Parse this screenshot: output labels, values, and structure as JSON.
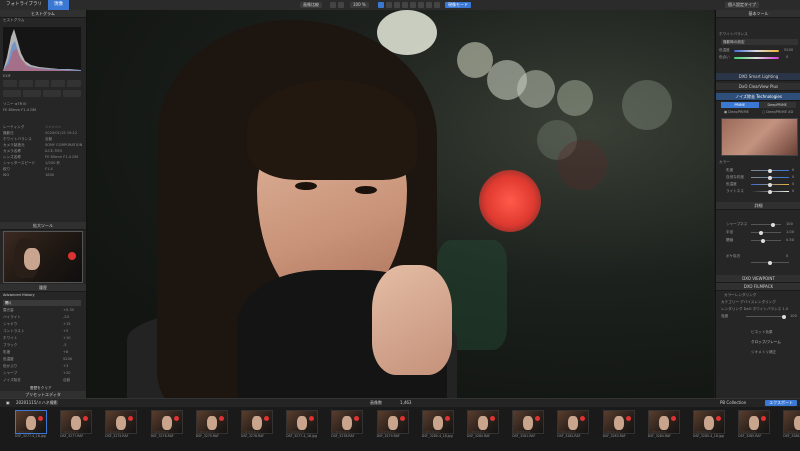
{
  "topbar": {
    "tabs": [
      {
        "label": "フォトライブラリ"
      },
      {
        "label": "現像"
      }
    ],
    "zoom_value": "100 %",
    "compare_label": "画像比較",
    "view_label": "表示",
    "nav_mode": "現像モード",
    "right_label": "個人設定タイプ"
  },
  "left_panel": {
    "histogram_title": "ヒストグラム",
    "histogram_sub": "ヒストグラム",
    "exif_title": "EXIF",
    "camera": "ソニー α7R III",
    "lens_line": "FE 85mm F1.4 GM",
    "info_rows": [
      {
        "label": "レーティング",
        "value": "☆☆☆☆☆"
      },
      {
        "label": "撮影日",
        "value": "2020/01/15 19:12"
      },
      {
        "label": "ホワイトバランス",
        "value": "自動"
      },
      {
        "label": "カメラ製造元",
        "value": "SONY CORPORATION"
      },
      {
        "label": "カメラ名称",
        "value": "ILCE-7M3"
      },
      {
        "label": "レンズ名称",
        "value": "FE 85mm F1.4 GM"
      },
      {
        "label": "シャッタースピード",
        "value": "1/200 秒"
      },
      {
        "label": "絞り",
        "value": "F1.4"
      },
      {
        "label": "ISO",
        "value": "1600"
      }
    ],
    "thumb_title": "拡大ツール",
    "history_title": "履歴",
    "history_sub": "Advanced History",
    "history_rows": [
      {
        "label": "開く",
        "value": ""
      },
      {
        "label": "露光量",
        "value": "+0.30"
      },
      {
        "label": "ハイライト",
        "value": "-20"
      },
      {
        "label": "シャドウ",
        "value": "+15"
      },
      {
        "label": "コントラスト",
        "value": "+5"
      },
      {
        "label": "ホワイト",
        "value": "+10"
      },
      {
        "label": "ブラック",
        "value": "-5"
      },
      {
        "label": "彩度",
        "value": "+8"
      },
      {
        "label": "色温度",
        "value": "5200"
      },
      {
        "label": "色かぶり",
        "value": "+3"
      },
      {
        "label": "シャープ",
        "value": "+20"
      },
      {
        "label": "ノイズ除去",
        "value": "自動"
      }
    ],
    "history_footer": "履歴をクリア",
    "bottom_title": "プリセットエディタ"
  },
  "right_panel": {
    "title": "基本ツール",
    "wb_title": "ホワイトバランス",
    "wb_mode": "撮影時の設定",
    "wb_items": [
      {
        "label": "色温度",
        "value": "5200"
      },
      {
        "label": "色合い",
        "value": "0"
      }
    ],
    "smart_lighting": "DXO Smart Lighting",
    "clear_view": "DxO ClearView Plus",
    "noise_title": "ノイズ除去 Technologies",
    "noise_tabs": [
      "PRIME",
      "DeepPRIME"
    ],
    "noise_options": [
      {
        "label": "DeepPRIME",
        "checked": true
      },
      {
        "label": "DeepPRIME XD",
        "checked": false
      }
    ],
    "color_title": "カラー",
    "color_rows": [
      {
        "label": "彩度",
        "value": "0"
      },
      {
        "label": "自然な彩度",
        "value": "0"
      },
      {
        "label": "色温度",
        "value": "0"
      },
      {
        "label": "ライトネス",
        "value": "0"
      }
    ],
    "detail_title": "詳細",
    "detail_rows": [
      {
        "label": "シャープネス",
        "value": "100"
      },
      {
        "label": "半径",
        "value": "1.00"
      },
      {
        "label": "閾値",
        "value": "0.50"
      },
      {
        "label": "ボケ除去",
        "value": "0"
      }
    ],
    "viewpoint": "DXO VIEWPOINT",
    "filmpack": "DXO FILMPACK",
    "filmpack_sub": "カラーレンダリング",
    "filmpack_rows": [
      {
        "label": "カテゴリー",
        "value": "デバイスレンダリング"
      },
      {
        "label": "レンダリング",
        "value": "DxO ホワイトバランス 1.0"
      },
      {
        "label": "強度",
        "value": "100"
      }
    ],
    "vignette": "ビネット効果",
    "crop": "クロップ/フレーム",
    "geometry": "ジオメトリ補正"
  },
  "filmstrip": {
    "folder_path": "20201115/ミハネ撮影",
    "count_label": "画像数",
    "count": "1,463",
    "export_label": "エクスポート",
    "collection_label": "PB Collection",
    "items": [
      {
        "name": "DSF_3277-4_18.jpg",
        "rating": "☆☆☆☆☆"
      },
      {
        "name": "DSF_3277.RAF",
        "rating": "☆☆☆☆☆"
      },
      {
        "name": "DSF_3275.RAF",
        "rating": "☆☆☆☆☆"
      },
      {
        "name": "DSF_3278.RAF",
        "rating": "☆☆☆☆☆"
      },
      {
        "name": "DSF_3279.RAF",
        "rating": "☆☆☆☆☆"
      },
      {
        "name": "DSF_3278.RAF",
        "rating": "☆☆☆☆☆"
      },
      {
        "name": "DSF_3277-4_18.jpg",
        "rating": "☆☆☆☆☆"
      },
      {
        "name": "DSF_3278.RAF",
        "rating": "☆☆☆☆☆"
      },
      {
        "name": "DSF_3279.RAF",
        "rating": "☆☆☆☆☆"
      },
      {
        "name": "DSF_3280-4_18.jpg",
        "rating": "☆☆☆☆☆"
      },
      {
        "name": "DSF_3280.RAF",
        "rating": "☆☆☆☆☆"
      },
      {
        "name": "DSF_3281.RAF",
        "rating": "☆☆☆☆☆"
      },
      {
        "name": "DSF_3282.RAF",
        "rating": "☆☆☆☆☆"
      },
      {
        "name": "DSF_3283.RAF",
        "rating": "☆☆☆☆☆"
      },
      {
        "name": "DSF_3284.RAF",
        "rating": "☆☆☆☆☆"
      },
      {
        "name": "DSF_3285-4_18.jpg",
        "rating": "☆☆☆☆☆"
      },
      {
        "name": "DSF_3285.RAF",
        "rating": "☆☆☆☆☆"
      },
      {
        "name": "DSF_3286.RAF",
        "rating": "☆☆☆☆☆"
      }
    ]
  },
  "colors": {
    "accent": "#3a78d4",
    "panel": "#262626",
    "bokeh_red": "#e04038"
  }
}
